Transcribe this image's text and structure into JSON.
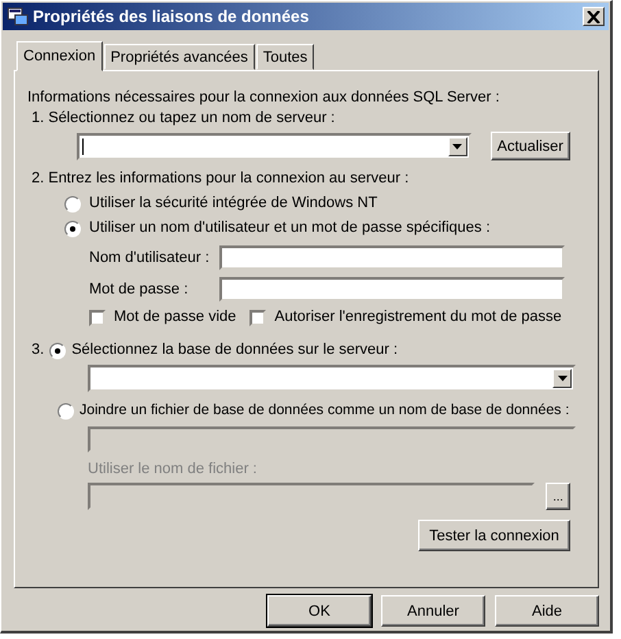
{
  "window": {
    "title": "Propriétés des liaisons de données"
  },
  "tabs": [
    {
      "label": "Connexion",
      "selected": true
    },
    {
      "label": "Propriétés avancées",
      "selected": false
    },
    {
      "label": "Toutes",
      "selected": false
    }
  ],
  "intro": "Informations nécessaires pour la connexion aux données SQL Server :",
  "step1": {
    "label": "1. Sélectionnez ou tapez un nom de serveur :",
    "refresh_button": "Actualiser"
  },
  "step2": {
    "label": "2. Entrez les informations pour la connexion au serveur :",
    "auth_options": [
      {
        "label": "Utiliser la sécurité intégrée de Windows NT",
        "selected": false
      },
      {
        "label": "Utiliser un nom d'utilisateur et un mot de passe spécifiques :",
        "selected": true
      }
    ],
    "fields": [
      {
        "label": "Nom d'utilisateur :"
      },
      {
        "label": "Mot de passe :"
      }
    ],
    "checkboxes": [
      {
        "label": "Mot de passe vide",
        "checked": false
      },
      {
        "label": "Autoriser l'enregistrement du mot de passe",
        "checked": false
      }
    ]
  },
  "step3": {
    "number": "3.",
    "options": [
      {
        "label": "Sélectionnez la base de données sur le serveur :",
        "selected": true,
        "disabled": false
      },
      {
        "label": "Joindre un fichier de base de données comme un nom de base de données :",
        "selected": false,
        "disabled": false
      }
    ],
    "file_label": {
      "text": "Utiliser le nom de fichier :",
      "disabled": true
    },
    "browse_button": "...",
    "test_button": "Tester la connexion"
  },
  "buttons": [
    {
      "label": "OK",
      "default": true
    },
    {
      "label": "Annuler",
      "default": false
    },
    {
      "label": "Aide",
      "default": false
    }
  ]
}
